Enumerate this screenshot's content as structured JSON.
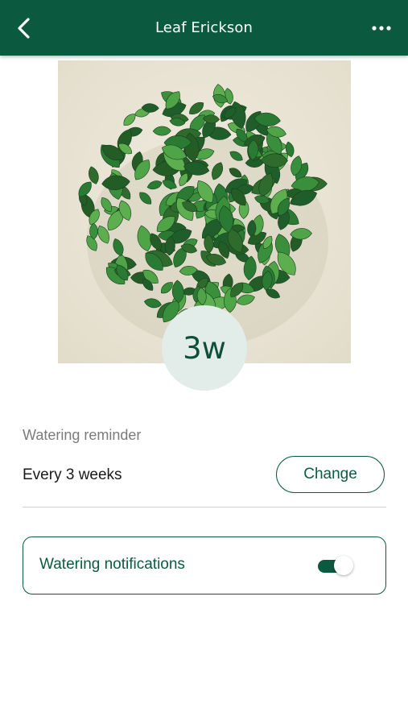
{
  "header": {
    "title": "Leaf Erickson",
    "back_icon": "chevron-left-icon",
    "more_icon": "more-horizontal-icon"
  },
  "plant": {
    "photo_subject": "pothos-wall-planter",
    "badge_text": "3w"
  },
  "watering": {
    "section_label": "Watering reminder",
    "schedule": "Every 3 weeks",
    "change_label": "Change"
  },
  "notifications": {
    "label": "Watering notifications",
    "enabled": true
  },
  "colors": {
    "brand": "#0b5a3f",
    "badge_bg": "#e2ece8",
    "photo_bg": "#ebe6d7"
  }
}
